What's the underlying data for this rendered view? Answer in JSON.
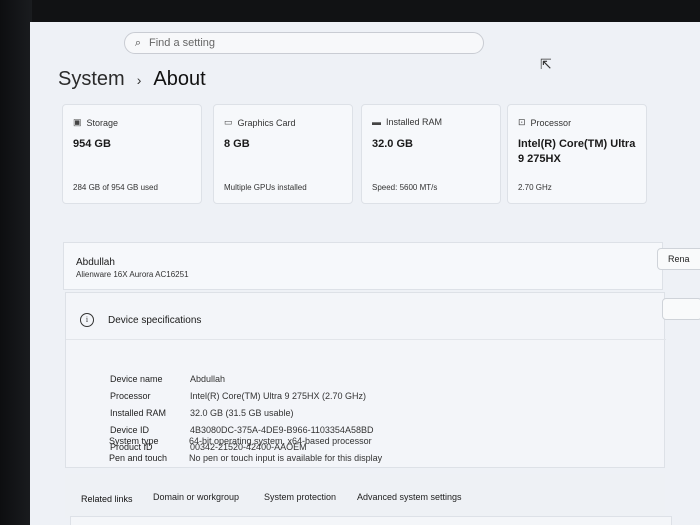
{
  "search": {
    "placeholder": "Find a setting"
  },
  "breadcrumb": {
    "root": "System",
    "separator": "›",
    "current": "About"
  },
  "cards": [
    {
      "title": "Storage",
      "value": "954 GB",
      "sub": "284 GB of 954 GB used",
      "icon": "storage-icon",
      "glyph": "▣"
    },
    {
      "title": "Graphics Card",
      "value": "8 GB",
      "sub": "Multiple GPUs installed",
      "icon": "graphics-card-icon",
      "glyph": "▭"
    },
    {
      "title": "Installed RAM",
      "value": "32.0 GB",
      "sub": "Speed: 5600 MT/s",
      "icon": "ram-icon",
      "glyph": "▬"
    },
    {
      "title": "Processor",
      "value": "Intel(R) Core(TM) Ultra 9 275HX",
      "sub": "2.70 GHz",
      "icon": "processor-icon",
      "glyph": "⊡"
    }
  ],
  "device": {
    "name": "Abdullah",
    "model": "Alienware 16X Aurora AC16251",
    "rename_label": "Rena"
  },
  "specs": {
    "title": "Device specifications",
    "rows": [
      {
        "label": "Device name",
        "value": "Abdullah"
      },
      {
        "label": "Processor",
        "value": "Intel(R) Core(TM) Ultra 9 275HX (2.70 GHz)"
      },
      {
        "label": "Installed RAM",
        "value": "32.0 GB (31.5 GB usable)"
      },
      {
        "label": "Device ID",
        "value": "4B3080DC-375A-4DE9-B966-1103354A58BD"
      },
      {
        "label": "Product ID",
        "value": "00342-21520-42400-AAOEM"
      },
      {
        "label": "System type",
        "value": "64-bit operating system, x64-based processor"
      },
      {
        "label": "Pen and touch",
        "value": "No pen or touch input is available for this display"
      }
    ]
  },
  "related": {
    "title": "Related links",
    "links": [
      "Domain or workgroup",
      "System protection",
      "Advanced system settings"
    ]
  }
}
